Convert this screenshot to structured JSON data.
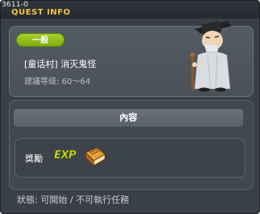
{
  "window": {
    "quest_id": "3611-0",
    "title": "QUEST INFO"
  },
  "quest": {
    "category_badge": "一般",
    "name": "[童话村] 消灭鬼怪",
    "recommended_level": "建議等级: 60～64"
  },
  "content": {
    "header": "內容"
  },
  "reward": {
    "label": "獎勵",
    "exp_text": "EXP"
  },
  "footer": {
    "status": "狀態: 可開始 / 不可執行任務"
  },
  "colors": {
    "title": "#f2c23a",
    "badge": "#8fbd18",
    "background": "#3a4047"
  },
  "icons": {
    "npc": "old-sage-npc",
    "reward": "exp-book-icon"
  }
}
